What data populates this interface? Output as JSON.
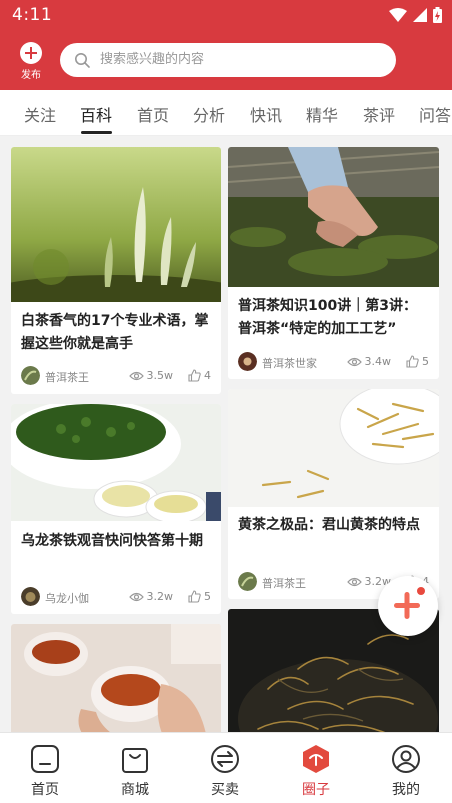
{
  "status_bar": {
    "time": "4:11"
  },
  "header": {
    "publish_label": "发布",
    "search_placeholder": "搜索感兴趣的内容"
  },
  "tabs": [
    {
      "label": "关注",
      "active": false
    },
    {
      "label": "百科",
      "active": true
    },
    {
      "label": "首页",
      "active": false
    },
    {
      "label": "分析",
      "active": false
    },
    {
      "label": "快讯",
      "active": false
    },
    {
      "label": "精华",
      "active": false
    },
    {
      "label": "茶评",
      "active": false
    },
    {
      "label": "问答",
      "active": false
    }
  ],
  "cards": [
    {
      "title": "白茶香气的17个专业术语，掌握这些你就是高手",
      "author": "普洱茶王",
      "views": "3.5w",
      "likes": "4"
    },
    {
      "title": "普洱茶知识100讲｜第3讲：普洱茶“特定的加工工艺”",
      "author": "普洱茶世家",
      "views": "3.4w",
      "likes": "5"
    },
    {
      "title": "乌龙茶铁观音快问快答第十期",
      "author": "乌龙小伽",
      "views": "3.2w",
      "likes": "5"
    },
    {
      "title": "黄茶之极品：君山黄茶的特点",
      "author": "普洱茶王",
      "views": "3.2w",
      "likes": "4"
    }
  ],
  "bottom_nav": [
    {
      "label": "首页",
      "icon": "home-icon"
    },
    {
      "label": "商城",
      "icon": "shopping-bag-icon"
    },
    {
      "label": "买卖",
      "icon": "exchange-icon"
    },
    {
      "label": "圈子",
      "icon": "circle-hexagon-icon",
      "active": true
    },
    {
      "label": "我的",
      "icon": "profile-icon"
    }
  ],
  "colors": {
    "brand_red": "#d83a3f",
    "tab_active": "#222222",
    "text_meta": "#888888"
  }
}
